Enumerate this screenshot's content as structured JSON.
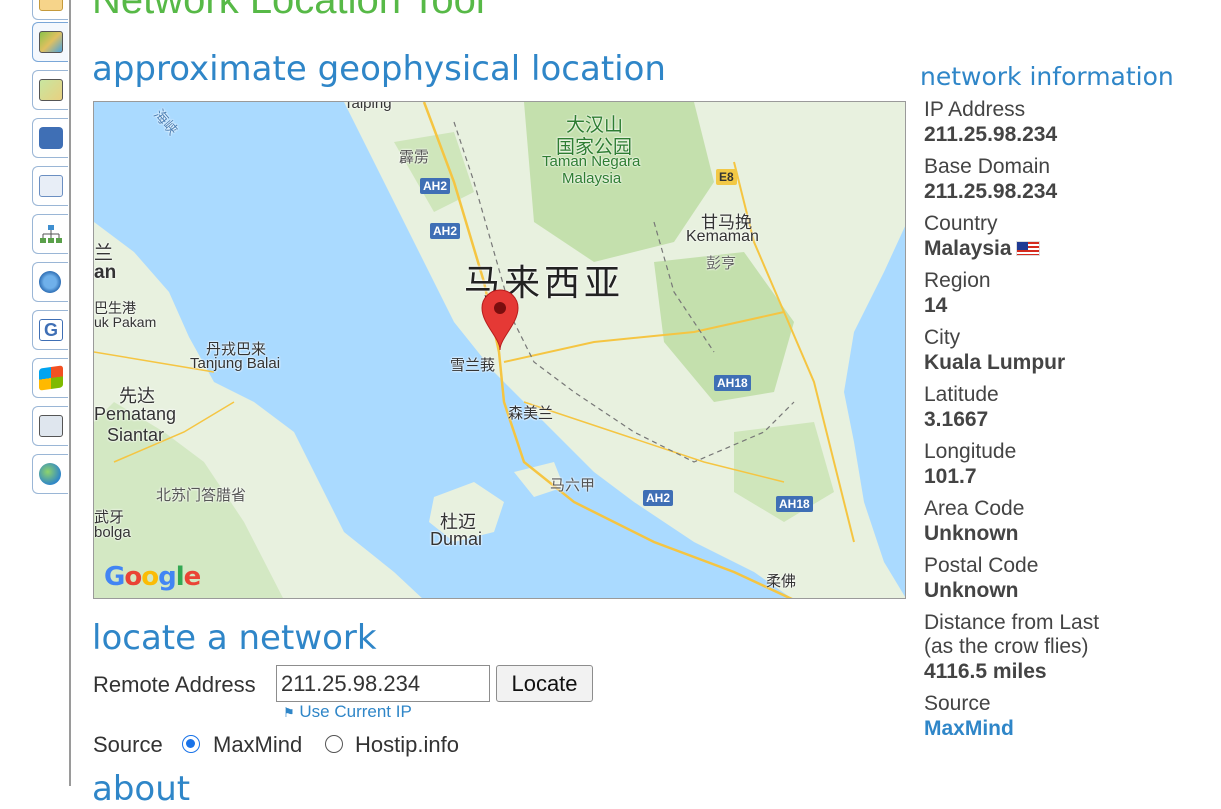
{
  "page": {
    "title": "Network Location Tool",
    "map_heading": "approximate geophysical location",
    "locate_heading": "locate a network",
    "network_heading": "network information",
    "cut_heading": "about"
  },
  "toolbar": {
    "items": [
      {
        "icon": "notes-icon"
      },
      {
        "icon": "network-map-icon",
        "active": true
      },
      {
        "icon": "map-edit-icon"
      },
      {
        "icon": "phone-icon"
      },
      {
        "icon": "mail-icon"
      },
      {
        "icon": "hierarchy-icon"
      },
      {
        "icon": "help-icon"
      },
      {
        "icon": "google-icon"
      },
      {
        "icon": "windows-icon"
      },
      {
        "icon": "document-icon"
      },
      {
        "icon": "globe-icon"
      }
    ]
  },
  "map": {
    "labels": {
      "taiping": "Taiping",
      "taman_negara_cn": "大汉山",
      "taman_negara_cn2": "国家公园",
      "taman_negara": "Taman Negara",
      "taman_negara2": "Malaysia",
      "gerik": "霹雳",
      "kemaman_cn": "甘马挽",
      "kemaman": "Kemaman",
      "kemaman_sub": "彭亨",
      "malaysia_cn": "马来西亚",
      "an_cn": "兰",
      "an": "an",
      "klang_port_cn": "巴生港",
      "uk_pakam": "uk Pakam",
      "tanjung_balai_cn": "丹戎巴来",
      "tanjung_balai": "Tanjung Balai",
      "pematang_cn": "先达",
      "pematang": "Pematang",
      "siantar": "Siantar",
      "selangor_cn": "雪兰莪",
      "seremban_cn": "森美兰",
      "malacca_cn": "马六甲",
      "north_sumatra_cn": "北苏门答腊省",
      "dumai_cn": "杜迈",
      "dumai": "Dumai",
      "bagan_cn": "武牙",
      "bolga": "bolga",
      "johor_cn": "柔佛",
      "strait_cn": "海峡"
    },
    "shields": [
      "AH2",
      "AH2",
      "E8",
      "AH18",
      "AH2",
      "AH18"
    ],
    "logo": "Google",
    "marker_color": "#e53935"
  },
  "form": {
    "remote_label": "Remote Address",
    "ip_value": "211.25.98.234",
    "locate_button": "Locate",
    "use_current_ip": "Use Current IP",
    "source_label": "Source",
    "source_options": [
      "MaxMind",
      "Hostip.info"
    ],
    "selected_source": "MaxMind"
  },
  "info": {
    "ip_label": "IP Address",
    "ip_value": "211.25.98.234",
    "domain_label": "Base Domain",
    "domain_value": "211.25.98.234",
    "country_label": "Country",
    "country_value": "Malaysia",
    "region_label": "Region",
    "region_value": "14",
    "city_label": "City",
    "city_value": "Kuala Lumpur",
    "lat_label": "Latitude",
    "lat_value": "3.1667",
    "lon_label": "Longitude",
    "lon_value": "101.7",
    "area_label": "Area Code",
    "area_value": "Unknown",
    "postal_label": "Postal Code",
    "postal_value": "Unknown",
    "distance_label": "Distance from Last",
    "distance_sub": "(as the crow flies)",
    "distance_value": "4116.5 miles",
    "source_label": "Source",
    "source_value": "MaxMind"
  },
  "colors": {
    "brand_green": "#57b947",
    "heading_blue": "#2f86c8",
    "water": "#aadaff",
    "land": "#e8f1df"
  }
}
